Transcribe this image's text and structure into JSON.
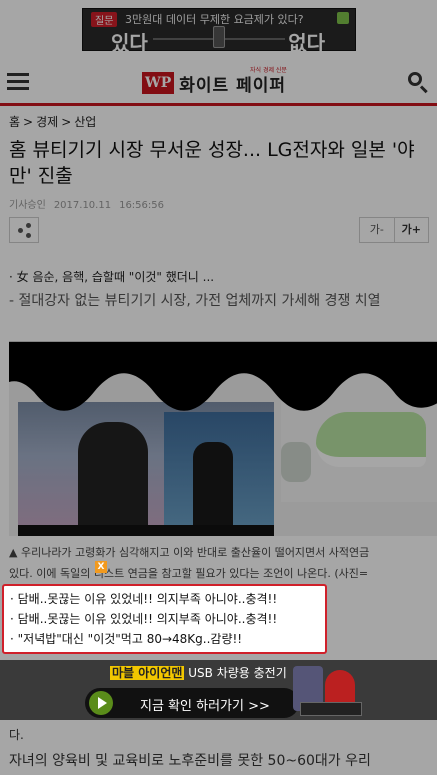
{
  "top_ad": {
    "badge": "질문",
    "question": "3만원대 데이터 무제한 요금제가 있다?",
    "left_text": "있다",
    "right_text": "없다"
  },
  "header": {
    "logo_mark": "WP",
    "logo_name": "화이트 페이퍼",
    "logo_tagline": "자식 경제 신문"
  },
  "breadcrumb": [
    "홈",
    "경제",
    "산업"
  ],
  "article": {
    "title": "홈 뷰티기기 시장 무서운 성장... LG전자와 일본 '야만' 진출",
    "date_label": "기사승인",
    "date": "2017.10.11",
    "time": "16:56:56",
    "font_small": "가-",
    "font_large": "가+",
    "related_link": "· 女 음순, 음핵, 습할때 \"이것\" 했더니 ...",
    "summary": "- 절대강자 없는 뷰티기기 시장, 가전 업체까지 가세해 경쟁 치열",
    "caption_line1": "▲ 우리나라가 고령화가 심각해지고 이와 반대로 출산율이 떨어지면서 사적연금",
    "caption_line2": "있다. 이에 독일의 리스트 연금을 참고할 필요가 있다는 조언이 나온다. (사진=",
    "body_letter": "다.",
    "body_text": "자녀의 양육비 및 교육비로 노후준비를 못한 50~60대가 우리"
  },
  "popup_links": [
    "· 담배..못끊는 이유 있었네!! 의지부족 아니야..충격!!",
    "· 담배..못끊는 이유 있었네!! 의지부족 아니야..충격!!",
    "· \"저녁밥\"대신 \"이것\"먹고 80→48Kg..감량!!"
  ],
  "close_label": "X",
  "bottom_ad": {
    "title_highlight": "마블 아이언맨",
    "title_rest": "USB 차량용 충전기",
    "cta": "지금 확인 하러가기 >>"
  },
  "colors": {
    "brand_red": "#c8141e",
    "popup_border": "#d0202a",
    "ad_cta_green": "#5a8c1a"
  }
}
